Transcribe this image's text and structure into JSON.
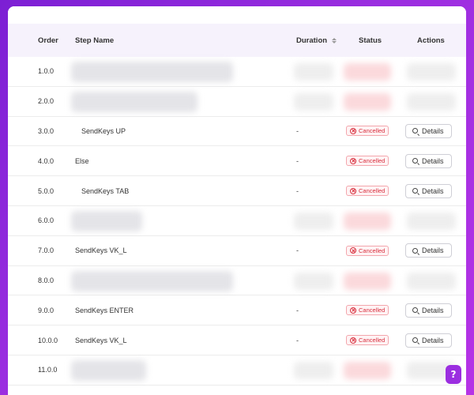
{
  "table": {
    "columns": {
      "order": "Order",
      "step_name": "Step Name",
      "duration": "Duration",
      "status": "Status",
      "actions": "Actions"
    },
    "rows": [
      {
        "order": "1.0.0",
        "step_name": null,
        "duration": null,
        "status": null,
        "action": null,
        "redacted": true
      },
      {
        "order": "2.0.0",
        "step_name": null,
        "duration": null,
        "status": null,
        "action": null,
        "redacted": true
      },
      {
        "order": "3.0.0",
        "step_name": "SendKeys UP",
        "duration": "-",
        "status": "Cancelled",
        "action": "Details",
        "indent": true
      },
      {
        "order": "4.0.0",
        "step_name": "Else",
        "duration": "-",
        "status": "Cancelled",
        "action": "Details",
        "indent": false
      },
      {
        "order": "5.0.0",
        "step_name": "SendKeys TAB",
        "duration": "-",
        "status": "Cancelled",
        "action": "Details",
        "indent": true
      },
      {
        "order": "6.0.0",
        "step_name": null,
        "duration": null,
        "status": null,
        "action": null,
        "redacted": true
      },
      {
        "order": "7.0.0",
        "step_name": "SendKeys VK_L",
        "duration": "-",
        "status": "Cancelled",
        "action": "Details",
        "indent": false
      },
      {
        "order": "8.0.0",
        "step_name": null,
        "duration": null,
        "status": null,
        "action": null,
        "redacted": true
      },
      {
        "order": "9.0.0",
        "step_name": "SendKeys ENTER",
        "duration": "-",
        "status": "Cancelled",
        "action": "Details",
        "indent": false
      },
      {
        "order": "10.0.0",
        "step_name": "SendKeys VK_L",
        "duration": "-",
        "status": "Cancelled",
        "action": "Details",
        "indent": false
      },
      {
        "order": "11.0.0",
        "step_name": null,
        "duration": null,
        "status": null,
        "action": null,
        "redacted": true
      }
    ]
  },
  "help_button": {
    "label": "?"
  },
  "colors": {
    "background_accent": "#9b2ee0",
    "header_bg": "#f6f2fc",
    "status_cancelled": "#d8303f"
  },
  "icons": {
    "sort": "sort-icon",
    "status_cancelled": "cancel-circle-icon",
    "details": "search-icon",
    "help": "help-icon"
  }
}
